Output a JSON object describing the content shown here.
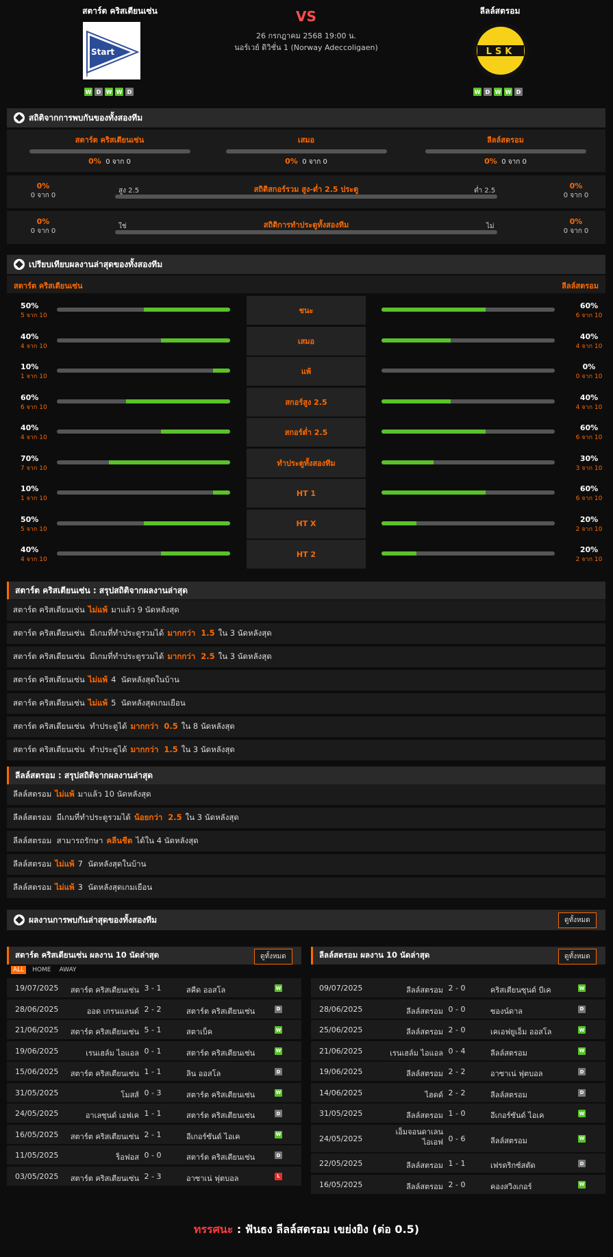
{
  "header": {
    "home": {
      "name": "สตาร์ต คริสเตียนเซ่น",
      "logo_text": "Start",
      "form": [
        "W",
        "D",
        "W",
        "W",
        "D"
      ]
    },
    "away": {
      "name": "ลีลล์สตรอม",
      "logo_text": "LSK",
      "form": [
        "W",
        "D",
        "W",
        "W",
        "D"
      ]
    },
    "vs": "VS",
    "date": "26 กรกฎาคม 2568 19:00 น.",
    "league": "นอร์เวย์ ดิวิชั่น 1 (Norway Adeccoligaen)"
  },
  "h2h": {
    "title": "สถิติจากการพบกันของทั้งสองทีม",
    "cols": [
      {
        "label": "สตาร์ต คริสเตียนเซ่น",
        "pct": "0%",
        "count": "0 จาก 0"
      },
      {
        "label": "เสมอ",
        "pct": "0%",
        "count": "0 จาก 0"
      },
      {
        "label": "ลีลล์สตรอม",
        "pct": "0%",
        "count": "0 จาก 0"
      }
    ],
    "ou": {
      "left_pct": "0%",
      "left_count": "0 จาก 0",
      "low": "สูง 2.5",
      "title": "สถิติสกอร์รวม สูง-ต่ำ 2.5 ประตู",
      "high": "ต่ำ 2.5",
      "right_pct": "0%",
      "right_count": "0 จาก 0"
    },
    "btts": {
      "left_pct": "0%",
      "left_count": "0 จาก 0",
      "low": "ใช่",
      "title": "สถิติการทำประตูทั้งสองทีม",
      "high": "ไม่",
      "right_pct": "0%",
      "right_count": "0 จาก 0"
    }
  },
  "compare": {
    "title": "เปรียบเทียบผลงานล่าสุดของทั้งสองทีม",
    "home": "สตาร์ต คริสเตียนเซ่น",
    "away": "ลีลล์สตรอม",
    "rows": [
      {
        "label": "ชนะ",
        "home_pct": "50%",
        "home_count": "5 จาก 10",
        "home_val": 0.5,
        "away_pct": "60%",
        "away_count": "6 จาก 10",
        "away_val": 0.6
      },
      {
        "label": "เสมอ",
        "home_pct": "40%",
        "home_count": "4 จาก 10",
        "home_val": 0.4,
        "away_pct": "40%",
        "away_count": "4 จาก 10",
        "away_val": 0.4
      },
      {
        "label": "แพ้",
        "home_pct": "10%",
        "home_count": "1 จาก 10",
        "home_val": 0.1,
        "away_pct": "0%",
        "away_count": "0 จาก 10",
        "away_val": 0
      },
      {
        "label": "สกอร์สูง 2.5",
        "home_pct": "60%",
        "home_count": "6 จาก 10",
        "home_val": 0.6,
        "away_pct": "40%",
        "away_count": "4 จาก 10",
        "away_val": 0.4
      },
      {
        "label": "สกอร์ต่ำ 2.5",
        "home_pct": "40%",
        "home_count": "4 จาก 10",
        "home_val": 0.4,
        "away_pct": "60%",
        "away_count": "6 จาก 10",
        "away_val": 0.6
      },
      {
        "label": "ทำประตูทั้งสองทีม",
        "home_pct": "70%",
        "home_count": "7 จาก 10",
        "home_val": 0.7,
        "away_pct": "30%",
        "away_count": "3 จาก 10",
        "away_val": 0.3
      },
      {
        "label": "HT 1",
        "home_pct": "10%",
        "home_count": "1 จาก 10",
        "home_val": 0.1,
        "away_pct": "60%",
        "away_count": "6 จาก 10",
        "away_val": 0.6
      },
      {
        "label": "HT X",
        "home_pct": "50%",
        "home_count": "5 จาก 10",
        "home_val": 0.5,
        "away_pct": "20%",
        "away_count": "2 จาก 10",
        "away_val": 0.2
      },
      {
        "label": "HT 2",
        "home_pct": "40%",
        "home_count": "4 จาก 10",
        "home_val": 0.4,
        "away_pct": "20%",
        "away_count": "2 จาก 10",
        "away_val": 0.2
      }
    ]
  },
  "home_summary": {
    "title": "สตาร์ต คริสเตียนเซ่น : สรุปสถิติจากผลงานล่าสุด",
    "rows": [
      {
        "pre": "สตาร์ต คริสเตียนเซ่น",
        "hl": "ไม่แพ้",
        "post": "มาแล้ว 9 นัดหลังสุด"
      },
      {
        "pre": "สตาร์ต คริสเตียนเซ่น  มีเกมที่ทำประตูรวมได้",
        "hl": "มากกว่า  1.5",
        "post": "ใน 3 นัดหลังสุด"
      },
      {
        "pre": "สตาร์ต คริสเตียนเซ่น  มีเกมที่ทำประตูรวมได้",
        "hl": "มากกว่า  2.5",
        "post": "ใน 3 นัดหลังสุด"
      },
      {
        "pre": "สตาร์ต คริสเตียนเซ่น",
        "hl": "ไม่แพ้",
        "post": "4  นัดหลังสุดในบ้าน"
      },
      {
        "pre": "สตาร์ต คริสเตียนเซ่น",
        "hl": "ไม่แพ้",
        "post": "5  นัดหลังสุดเกมเยือน"
      },
      {
        "pre": "สตาร์ต คริสเตียนเซ่น  ทำประตูได้",
        "hl": "มากกว่า  0.5",
        "post": "ใน 8 นัดหลังสุด"
      },
      {
        "pre": "สตาร์ต คริสเตียนเซ่น  ทำประตูได้",
        "hl": "มากกว่า  1.5",
        "post": "ใน 3 นัดหลังสุด"
      }
    ]
  },
  "away_summary": {
    "title": "ลีลล์สตรอม : สรุปสถิติจากผลงานล่าสุด",
    "rows": [
      {
        "pre": "ลีลล์สตรอม",
        "hl": "ไม่แพ้",
        "post": "มาแล้ว 10 นัดหลังสุด"
      },
      {
        "pre": "ลีลล์สตรอม  มีเกมที่ทำประตูรวมได้",
        "hl": "น้อยกว่า  2.5",
        "post": "ใน 3 นัดหลังสุด"
      },
      {
        "pre": "ลีลล์สตรอม  สามารถรักษา",
        "hl": "คลีนชีต",
        "post": "ได้ใน 4 นัดหลังสุด"
      },
      {
        "pre": "ลีลล์สตรอม",
        "hl": "ไม่แพ้",
        "post": "7  นัดหลังสุดในบ้าน"
      },
      {
        "pre": "ลีลล์สตรอม",
        "hl": "ไม่แพ้",
        "post": "3  นัดหลังสุดเกมเยือน"
      }
    ]
  },
  "recent": {
    "title": "ผลงานการพบกันล่าสุดของทั้งสองทีม",
    "view_all": "ดูทั้งหมด",
    "tabs": [
      "ALL",
      "HOME",
      "AWAY"
    ],
    "home": {
      "title": "สตาร์ต คริสเตียนเซ่น ผลงาน 10 นัดล่าสุด",
      "matches": [
        {
          "date": "19/07/2025",
          "home": "สตาร์ต คริสเตียนเซ่น",
          "score": "3 - 1",
          "away": "สคีด ออสโล",
          "res": "W"
        },
        {
          "date": "28/06/2025",
          "home": "ออด เกรนแลนด์",
          "score": "2 - 2",
          "away": "สตาร์ต คริสเตียนเซ่น",
          "res": "D"
        },
        {
          "date": "21/06/2025",
          "home": "สตาร์ต คริสเตียนเซ่น",
          "score": "5 - 1",
          "away": "สตาเบ็ค",
          "res": "W"
        },
        {
          "date": "19/06/2025",
          "home": "เรนเฮล์ม ไอแอล",
          "score": "0 - 1",
          "away": "สตาร์ต คริสเตียนเซ่น",
          "res": "W"
        },
        {
          "date": "15/06/2025",
          "home": "สตาร์ต คริสเตียนเซ่น",
          "score": "1 - 1",
          "away": "ลิน ออสโล",
          "res": "D"
        },
        {
          "date": "31/05/2025",
          "home": "โมสส์",
          "score": "0 - 3",
          "away": "สตาร์ต คริสเตียนเซ่น",
          "res": "W"
        },
        {
          "date": "24/05/2025",
          "home": "อาเลซุนด์ เอฟเค",
          "score": "1 - 1",
          "away": "สตาร์ต คริสเตียนเซ่น",
          "res": "D"
        },
        {
          "date": "16/05/2025",
          "home": "สตาร์ต คริสเตียนเซ่น",
          "score": "2 - 1",
          "away": "อีเกอร์ซันด์ ไอเค",
          "res": "W"
        },
        {
          "date": "11/05/2025",
          "home": "ร็อฟอส",
          "score": "0 - 0",
          "away": "สตาร์ต คริสเตียนเซ่น",
          "res": "D"
        },
        {
          "date": "03/05/2025",
          "home": "สตาร์ต คริสเตียนเซ่น",
          "score": "2 - 3",
          "away": "อาซาเน่ ฟุตบอล",
          "res": "L"
        }
      ]
    },
    "away": {
      "title": "ลีลล์สตรอม ผลงาน 10 นัดล่าสุด",
      "matches": [
        {
          "date": "09/07/2025",
          "home": "ลีลล์สตรอม",
          "score": "2 - 0",
          "away": "คริสเตียนซุนด์ บีเค",
          "res": "W"
        },
        {
          "date": "28/06/2025",
          "home": "ลีลล์สตรอม",
          "score": "0 - 0",
          "away": "ซองน์ดาล",
          "res": "D"
        },
        {
          "date": "25/06/2025",
          "home": "ลีลล์สตรอม",
          "score": "2 - 0",
          "away": "เคเอฟยูเอ็ม ออสโล",
          "res": "W"
        },
        {
          "date": "21/06/2025",
          "home": "เรนเฮล์ม ไอแอล",
          "score": "0 - 4",
          "away": "ลีลล์สตรอม",
          "res": "W"
        },
        {
          "date": "19/06/2025",
          "home": "ลีลล์สตรอม",
          "score": "2 - 2",
          "away": "อาซาเน่ ฟุตบอล",
          "res": "D"
        },
        {
          "date": "14/06/2025",
          "home": "ไฮดด์",
          "score": "2 - 2",
          "away": "ลีลล์สตรอม",
          "res": "D"
        },
        {
          "date": "31/05/2025",
          "home": "ลีลล์สตรอม",
          "score": "1 - 0",
          "away": "อีเกอร์ซันด์ ไอเค",
          "res": "W"
        },
        {
          "date": "24/05/2025",
          "home": "เอ็มจอนดาเลน ไอเอฟ",
          "score": "0 - 6",
          "away": "ลีลล์สตรอม",
          "res": "W"
        },
        {
          "date": "22/05/2025",
          "home": "ลีลล์สตรอม",
          "score": "1 - 1",
          "away": "เฟรดริกซ์สตัด",
          "res": "D"
        },
        {
          "date": "16/05/2025",
          "home": "ลีลล์สตรอม",
          "score": "2 - 0",
          "away": "คองสวิงเกอร์",
          "res": "W"
        }
      ]
    }
  },
  "verdict": {
    "label": "ทรรศนะ",
    "sep": ":",
    "text": "ฟันธง ลีลล์สตรอม เขย่งยิง (ต่อ 0.5)"
  },
  "colors": {
    "accent": "#ff6a00",
    "win": "#5ac229",
    "draw": "#777777",
    "loss": "#e52d2d",
    "verdict": "#ff3c3c"
  }
}
